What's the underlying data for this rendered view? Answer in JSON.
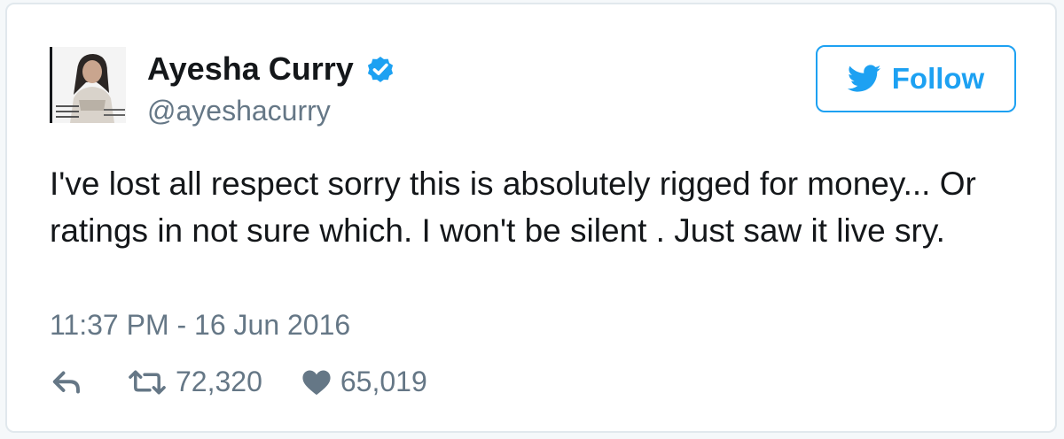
{
  "tweet": {
    "author": {
      "name": "Ayesha Curry",
      "handle": "@ayeshacurry",
      "verified": true
    },
    "follow_button": {
      "label": "Follow",
      "icon": "twitter-bird-icon"
    },
    "text": "I've lost all respect sorry this is absolutely rigged for money... Or ratings in not sure which. I won't be silent . Just saw it live sry.",
    "timestamp": "11:37 PM - 16 Jun 2016",
    "actions": {
      "reply_icon": "reply-icon",
      "retweet_icon": "retweet-icon",
      "retweet_count": "72,320",
      "like_icon": "heart-icon",
      "like_count": "65,019"
    }
  },
  "colors": {
    "accent": "#1da1f2",
    "text": "#14171a",
    "muted": "#657786",
    "verified": "#1da1f2",
    "border": "#e1e8ed"
  }
}
